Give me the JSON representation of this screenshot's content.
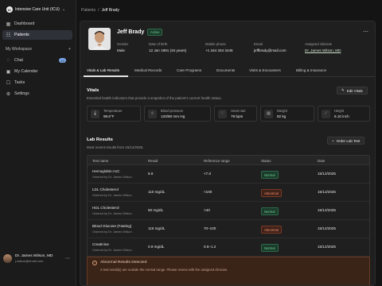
{
  "sidebar": {
    "unit_logo": "IC",
    "unit_name": "Intensive Care Unit (ICU)",
    "items": [
      {
        "label": "Dashboard",
        "icon": "dashboard-icon"
      },
      {
        "label": "Patients",
        "icon": "patients-icon"
      }
    ],
    "workspace_label": "My Workspace",
    "workspace_items": [
      {
        "label": "Chat",
        "icon": "chat-icon",
        "count": "12"
      },
      {
        "label": "My Calendar",
        "icon": "calendar-icon"
      },
      {
        "label": "Tasks",
        "icon": "tasks-icon"
      },
      {
        "label": "Settings",
        "icon": "gear-icon"
      }
    ],
    "user": {
      "name": "Dr. James Wilson, MD",
      "email": "j.wilson@email.com"
    }
  },
  "breadcrumb": {
    "parent": "Patients",
    "separator": "/",
    "current": "Jeff Brady"
  },
  "patient": {
    "name": "Jeff Brady",
    "status": "Active",
    "fields": [
      {
        "label": "Gender",
        "value": "Male"
      },
      {
        "label": "Date of birth",
        "value": "12 Jan 1991 (34 years)"
      },
      {
        "label": "Mobile phone",
        "value": "+1 344 334 3445"
      },
      {
        "label": "Email",
        "value": "jeffbrady@mail.com"
      },
      {
        "label": "Assigned clinician",
        "value": "Dr. James Wilson, MD"
      }
    ]
  },
  "tabs": [
    "Vitals & Lab Results",
    "Medical Records",
    "Care Programs",
    "Documents",
    "Visits & Encounters",
    "Billing & Insurance"
  ],
  "vitals": {
    "title": "Vitals",
    "subtitle": "Essential health indicators that provide a snapshot of the patient's current health status.",
    "edit_label": "Edit Vitals",
    "items": [
      {
        "label": "Temperature",
        "value": "98.6°F",
        "icon": "thermometer-icon"
      },
      {
        "label": "Blood pressure",
        "value": "120/80 mm Hg",
        "icon": "blood-drop-icon"
      },
      {
        "label": "Heart rate",
        "value": "79 bpm",
        "icon": "heart-icon"
      },
      {
        "label": "Weight",
        "value": "82 kg",
        "icon": "scale-icon"
      },
      {
        "label": "Height",
        "value": "5.10 inch",
        "icon": "ruler-icon"
      }
    ]
  },
  "labs": {
    "title": "Lab Results",
    "subtitle": "Most recent results from 15/12/2025.",
    "order_label": "Order Lab Test",
    "columns": [
      "Test name",
      "Result",
      "Reference range",
      "Status",
      "Date"
    ],
    "rows": [
      {
        "name": "Hemoglobin A1C",
        "by": "Ordered by Dr. James Wilson",
        "result": "6.6",
        "range": "<7.0",
        "status": "Normal",
        "date": "15/12/2025"
      },
      {
        "name": "LDL Cholesterol",
        "by": "Ordered by Dr. James Wilson",
        "result": "110 mg/dL",
        "range": "<100",
        "status": "Abnormal",
        "date": "15/12/2025"
      },
      {
        "name": "HDL Cholesterol",
        "by": "Ordered by Dr. James Wilson",
        "result": "50 mg/dL",
        "range": ">40",
        "status": "Normal",
        "date": "15/12/2025"
      },
      {
        "name": "Blood Glucose (Fasting)",
        "by": "Ordered by Dr. James Wilson",
        "result": "116 mg/dL",
        "range": "70–100",
        "status": "Abnormal",
        "date": "15/12/2025"
      },
      {
        "name": "Creatinine",
        "by": "Ordered by Dr. James Wilson",
        "result": "0.9 mg/dL",
        "range": "0.6–1.2",
        "status": "Normal",
        "date": "15/12/2025"
      }
    ]
  },
  "alert": {
    "title": "Abnormal Results Detected",
    "text": "2 test result(s) are outside the normal range. Please review with the assigned clinician."
  },
  "colors": {
    "normal_text": "#6fd19a",
    "normal_bg": "#1b3a2a",
    "normal_border": "#2e6a4b",
    "abnormal_text": "#f08f6f",
    "abnormal_bg": "#3e2118",
    "abnormal_border": "#7a3a26"
  }
}
